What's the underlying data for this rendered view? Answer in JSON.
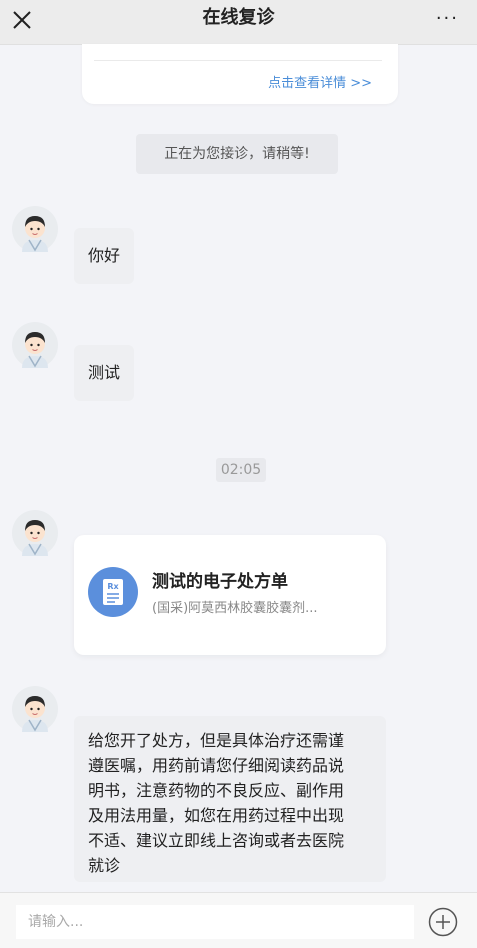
{
  "header": {
    "title": "在线复诊",
    "close_icon": "close-icon",
    "more_label": "···"
  },
  "top_card": {
    "link": "点击查看详情 >>"
  },
  "system_message": "正在为您接诊，请稍等!",
  "messages": [
    {
      "text": "你好"
    },
    {
      "text": "测试"
    }
  ],
  "timestamp": "02:05",
  "prescription": {
    "icon_text": "Rx",
    "title": "测试的电子处方单",
    "subtitle": "(国采)阿莫西林胶囊胶囊剂..."
  },
  "doctor_note": {
    "lines": [
      "给您开了处方，但是具体治疗还需谨",
      "遵医嘱，用药前请您仔细阅读药品说",
      "明书，注意药物的不良反应、副作用",
      "及用法用量，如您在用药过程中出现",
      "不适、建议立即线上咨询或者去医院",
      "就诊"
    ]
  },
  "input": {
    "placeholder": "请输入..."
  },
  "colors": {
    "link": "#4a8dd8",
    "rx_icon": "#5b8fdc"
  }
}
